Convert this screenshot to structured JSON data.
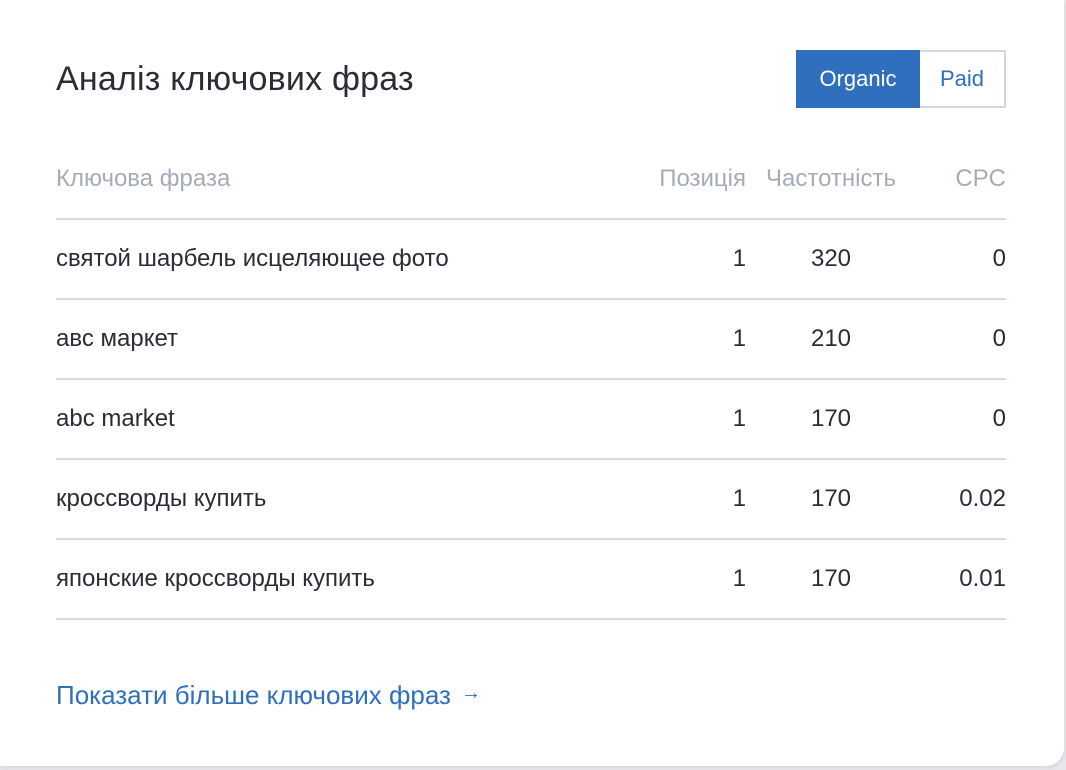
{
  "widget": {
    "title": "Аналіз ключових фраз",
    "toggle": {
      "organic_label": "Organic",
      "paid_label": "Paid",
      "active": "Organic"
    },
    "table": {
      "columns": {
        "phrase": "Ключова фраза",
        "position": "Позиція",
        "frequency": "Частотність",
        "cpc": "CPC"
      },
      "rows": [
        {
          "phrase": "святой шарбель исцеляющее фото",
          "position": "1",
          "frequency": "320",
          "cpc": "0"
        },
        {
          "phrase": "авс маркет",
          "position": "1",
          "frequency": "210",
          "cpc": "0"
        },
        {
          "phrase": "abc market",
          "position": "1",
          "frequency": "170",
          "cpc": "0"
        },
        {
          "phrase": "кроссворды купить",
          "position": "1",
          "frequency": "170",
          "cpc": "0.02"
        },
        {
          "phrase": "японские кроссворды купить",
          "position": "1",
          "frequency": "170",
          "cpc": "0.01"
        }
      ]
    },
    "more_link": "Показати більше ключових фраз",
    "more_link_icon": "arrow-right-icon"
  },
  "colors": {
    "accent": "#2f6fbd",
    "text": "#2a2d36",
    "muted": "#a6abb8",
    "divider": "#d6d9e1"
  }
}
